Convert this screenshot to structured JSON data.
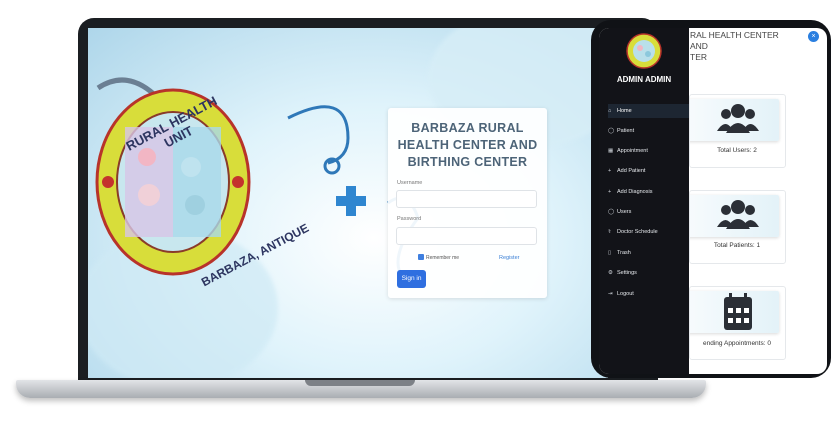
{
  "login": {
    "title_lines": [
      "BARBAZA RURAL",
      "HEALTH CENTER AND",
      "BIRTHING CENTER"
    ],
    "username_label": "Username",
    "password_label": "Password",
    "remember_label": "Remember me",
    "register_link": "Register",
    "signin_button": "Sign in"
  },
  "logo": {
    "top_text": "RURAL HEALTH UNIT",
    "bottom_text": "BARBAZA, ANTIQUE"
  },
  "dashboard": {
    "title_lines": [
      "RAL HEALTH CENTER AND",
      "TER"
    ],
    "close_glyph": "×",
    "user_name": "ADMIN ADMIN",
    "menu": [
      {
        "label": "Home",
        "icon": "home-icon",
        "glyph": "⌂"
      },
      {
        "label": "Patient",
        "icon": "user-icon",
        "glyph": "◯"
      },
      {
        "label": "Appointment",
        "icon": "calendar-icon",
        "glyph": "▦"
      },
      {
        "label": "Add Patient",
        "icon": "plus-icon",
        "glyph": "+"
      },
      {
        "label": "Add Diagnosis",
        "icon": "plus-icon",
        "glyph": "+"
      },
      {
        "label": "Users",
        "icon": "users-icon",
        "glyph": "◯"
      },
      {
        "label": "Doctor Schedule",
        "icon": "doctor-icon",
        "glyph": "⚕"
      },
      {
        "label": "Trash",
        "icon": "trash-icon",
        "glyph": "▯"
      },
      {
        "label": "Settings",
        "icon": "gear-icon",
        "glyph": "⚙"
      },
      {
        "label": "Logout",
        "icon": "logout-icon",
        "glyph": "⇥"
      }
    ],
    "cards": [
      {
        "label": "Total Users: 2",
        "icon": "users-icon"
      },
      {
        "label": "Total Patients: 1",
        "icon": "users-icon"
      },
      {
        "label": "ending Appointments: 0",
        "icon": "calendar-icon"
      }
    ]
  },
  "colors": {
    "accent": "#2f6fe0",
    "sidebar": "#121318",
    "title_text": "#4d6478"
  }
}
